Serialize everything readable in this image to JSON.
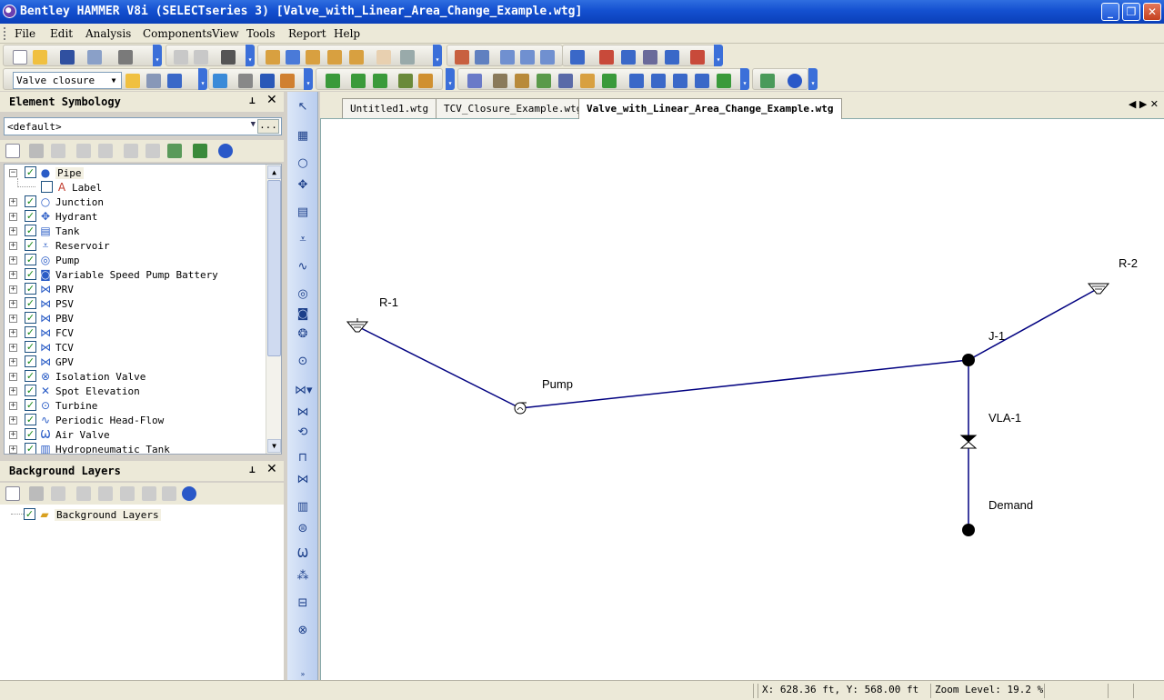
{
  "window": {
    "title": "Bentley HAMMER V8i (SELECTseries 3) [Valve_with_Linear_Area_Change_Example.wtg]",
    "minimize_glyph": "_",
    "maximize_glyph": "❐",
    "close_glyph": "✕"
  },
  "menu": [
    "File",
    "Edit",
    "Analysis",
    "Components",
    "View",
    "Tools",
    "Report",
    "Help"
  ],
  "toolbar": {
    "scenario_value": "Valve closure"
  },
  "element_symbology": {
    "title": "Element Symbology",
    "pin_glyph": "⊥",
    "close_glyph": "✕",
    "selected_profile": "<default>",
    "ellipsis": "...",
    "items": [
      {
        "label": "Pipe",
        "icon": "pipe-icon",
        "glyph": "●",
        "expanded": true,
        "checked": true
      },
      {
        "label": "Label",
        "icon": "label-icon",
        "glyph": "A",
        "child": true,
        "checked": false
      },
      {
        "label": "Junction",
        "icon": "junction-icon",
        "glyph": "○",
        "checked": true
      },
      {
        "label": "Hydrant",
        "icon": "hydrant-icon",
        "glyph": "✥",
        "checked": true
      },
      {
        "label": "Tank",
        "icon": "tank-icon",
        "glyph": "▤",
        "checked": true
      },
      {
        "label": "Reservoir",
        "icon": "reservoir-icon",
        "glyph": "⩡",
        "checked": true
      },
      {
        "label": "Pump",
        "icon": "pump-icon",
        "glyph": "◎",
        "checked": true
      },
      {
        "label": "Variable Speed Pump Battery",
        "icon": "vspb-icon",
        "glyph": "◙",
        "checked": true
      },
      {
        "label": "PRV",
        "icon": "prv-icon",
        "glyph": "⋈",
        "checked": true
      },
      {
        "label": "PSV",
        "icon": "psv-icon",
        "glyph": "⋈",
        "checked": true
      },
      {
        "label": "PBV",
        "icon": "pbv-icon",
        "glyph": "⋈",
        "checked": true
      },
      {
        "label": "FCV",
        "icon": "fcv-icon",
        "glyph": "⋈",
        "checked": true
      },
      {
        "label": "TCV",
        "icon": "tcv-icon",
        "glyph": "⋈",
        "checked": true
      },
      {
        "label": "GPV",
        "icon": "gpv-icon",
        "glyph": "⋈",
        "checked": true
      },
      {
        "label": "Isolation Valve",
        "icon": "isolation-valve-icon",
        "glyph": "⊗",
        "checked": true
      },
      {
        "label": "Spot Elevation",
        "icon": "spot-elevation-icon",
        "glyph": "✕",
        "checked": true
      },
      {
        "label": "Turbine",
        "icon": "turbine-icon",
        "glyph": "⊙",
        "checked": true
      },
      {
        "label": "Periodic Head-Flow",
        "icon": "periodic-head-flow-icon",
        "glyph": "∿",
        "checked": true
      },
      {
        "label": "Air Valve",
        "icon": "air-valve-icon",
        "glyph": "Ѡ",
        "checked": true
      },
      {
        "label": "Hydropneumatic Tank",
        "icon": "hydropneumatic-tank-icon",
        "glyph": "▥",
        "checked": true
      }
    ]
  },
  "background_layers": {
    "title": "Background Layers",
    "pin_glyph": "⊥",
    "close_glyph": "✕",
    "items": [
      {
        "label": "Background Layers",
        "checked": true
      }
    ]
  },
  "tabs": [
    {
      "label": "Untitled1.wtg",
      "active": false
    },
    {
      "label": "TCV_Closure_Example.wtg",
      "active": false
    },
    {
      "label": "Valve_with_Linear_Area_Change_Example.wtg",
      "active": true
    }
  ],
  "tab_nav": "◀ ▶ ✕",
  "network": {
    "labels": {
      "r1": "R-1",
      "r2": "R-2",
      "pump": "Pump",
      "j1": "J-1",
      "vla1": "VLA-1",
      "demand": "Demand"
    },
    "pipe_color": "#000080",
    "node_color": "#000000"
  },
  "status": {
    "coordinates": "X: 628.36 ft, Y: 568.00 ft",
    "zoom": "Zoom Level: 19.2 %"
  }
}
